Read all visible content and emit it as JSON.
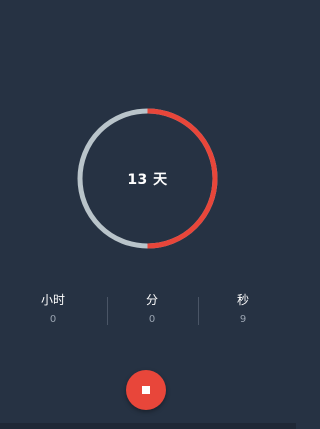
{
  "timer": {
    "days_label": "13 天",
    "progress_fraction": 0.5,
    "colors": {
      "background": "#263243",
      "track": "#b9c4ca",
      "progress": "#e8463a"
    }
  },
  "units": [
    {
      "label": "小时",
      "value": "0"
    },
    {
      "label": "分",
      "value": "0"
    },
    {
      "label": "秒",
      "value": "9"
    }
  ],
  "stop_button": {
    "icon": "stop-icon",
    "color": "#e8463a"
  }
}
